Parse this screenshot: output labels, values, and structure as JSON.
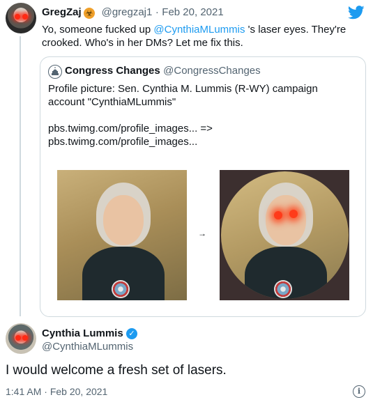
{
  "tweet1": {
    "display_name": "GregZaj",
    "handle": "@gregzaj1",
    "separator": "·",
    "date": "Feb 20, 2021",
    "text_part1": "Yo, someone fucked up ",
    "mention": "@CynthiaMLummis",
    "text_part2": " 's laser eyes. They're crooked.  Who's in her DMs?  Let me fix this.",
    "badge_icon": "biohazard-icon",
    "brand_icon": "twitter-bird-icon"
  },
  "quote": {
    "display_name": "Congress Changes",
    "handle": "@CongressChanges",
    "icon": "capitol-icon",
    "text_line1": "Profile picture: Sen. Cynthia M. Lummis (R-WY) campaign",
    "text_line2": "account \"CynthiaMLummis\"",
    "link_line1": "pbs.twimg.com/profile_images... =>",
    "link_line2": "pbs.twimg.com/profile_images...",
    "arrow": "→"
  },
  "reply": {
    "display_name": "Cynthia Lummis",
    "handle": "@CynthiaMLummis",
    "verified_icon": "verified-badge-icon",
    "text": "I would welcome a fresh set of lasers.",
    "time": "1:41 AM",
    "separator": "·",
    "date": "Feb 20, 2021",
    "info_icon": "info-icon"
  },
  "colors": {
    "accent": "#1d9bf0",
    "secondary_text": "#536471",
    "border": "#cfd9de"
  }
}
